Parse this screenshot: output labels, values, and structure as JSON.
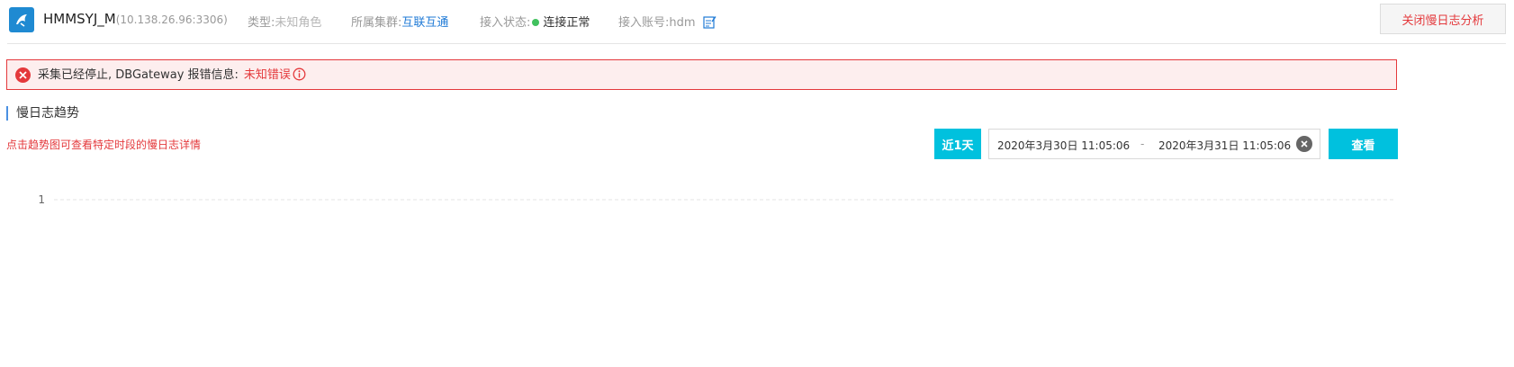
{
  "header": {
    "instance_name": "HMMSYJ_M",
    "instance_address": "(10.138.26.96:3306)",
    "type_label": "类型:",
    "type_value": "未知角色",
    "cluster_label": "所属集群:",
    "cluster_value": "互联互通",
    "status_label": "接入状态:",
    "status_value": "连接正常",
    "account_label": "接入账号:",
    "account_value": "hdm",
    "close_button_label": "关闭慢日志分析",
    "icons": {
      "logo": "mysql-dolphin-icon",
      "status": "status-dot-icon",
      "edit": "edit-icon"
    },
    "colors": {
      "status_ok": "#41c15e",
      "link": "#1f7ad6",
      "danger": "#e4393c"
    }
  },
  "alert": {
    "message": "采集已经停止, DBGateway 报错信息:",
    "error_text": "未知错误",
    "icons": {
      "error": "error-circle-icon",
      "info": "info-circle-icon"
    }
  },
  "section": {
    "title": "慢日志趋势",
    "hint": "点击趋势图可查看特定时段的慢日志详情"
  },
  "toolbar": {
    "recent_label": "近1天",
    "date_start": "2020年3月30日 11:05:06",
    "date_separator": "-",
    "date_end": "2020年3月31日 11:05:06",
    "view_label": "查看",
    "accent_color": "#00c1de"
  },
  "chart_data": {
    "type": "line",
    "yticks": [
      1
    ],
    "series": [],
    "grid": true
  }
}
